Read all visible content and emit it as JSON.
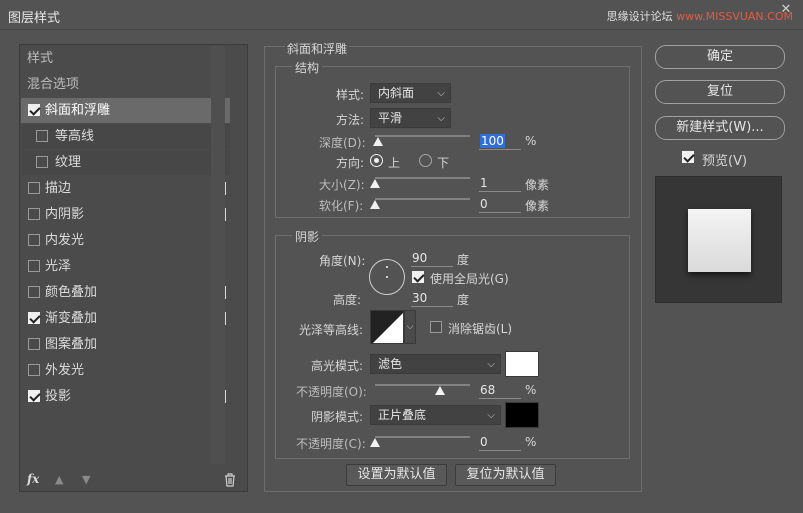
{
  "window": {
    "title": "图层样式",
    "close_label": "✕",
    "watermark": {
      "prefix": "思缘设计论坛 ",
      "highlight": "www.MISSVUAN.COM"
    }
  },
  "left_panel": {
    "items": [
      {
        "label": "样式",
        "checkbox": false,
        "checked": false,
        "plus": false,
        "selected": false
      },
      {
        "label": "混合选项",
        "checkbox": false,
        "checked": false,
        "plus": false,
        "selected": false
      },
      {
        "label": "斜面和浮雕",
        "checkbox": true,
        "checked": true,
        "plus": false,
        "selected": true
      },
      {
        "label": "等高线",
        "checkbox": true,
        "checked": false,
        "plus": false,
        "selected": false,
        "sub": true
      },
      {
        "label": "纹理",
        "checkbox": true,
        "checked": false,
        "plus": false,
        "selected": false,
        "sub": true
      },
      {
        "label": "描边",
        "checkbox": true,
        "checked": false,
        "plus": true,
        "selected": false
      },
      {
        "label": "内阴影",
        "checkbox": true,
        "checked": false,
        "plus": true,
        "selected": false
      },
      {
        "label": "内发光",
        "checkbox": true,
        "checked": false,
        "plus": false,
        "selected": false
      },
      {
        "label": "光泽",
        "checkbox": true,
        "checked": false,
        "plus": false,
        "selected": false
      },
      {
        "label": "颜色叠加",
        "checkbox": true,
        "checked": false,
        "plus": true,
        "selected": false
      },
      {
        "label": "渐变叠加",
        "checkbox": true,
        "checked": true,
        "plus": true,
        "selected": false
      },
      {
        "label": "图案叠加",
        "checkbox": true,
        "checked": false,
        "plus": false,
        "selected": false
      },
      {
        "label": "外发光",
        "checkbox": true,
        "checked": false,
        "plus": false,
        "selected": false
      },
      {
        "label": "投影",
        "checkbox": true,
        "checked": true,
        "plus": true,
        "selected": false
      }
    ],
    "footer": {
      "fx_label": "fx",
      "up_icon": "arrow-up-icon",
      "down_icon": "arrow-down-icon",
      "trash_icon": "trash-icon"
    }
  },
  "bevel": {
    "section_title": "斜面和浮雕",
    "structure_title": "结构",
    "style_label": "样式:",
    "style_value": "内斜面",
    "technique_label": "方法:",
    "technique_value": "平滑",
    "depth_label": "深度(D):",
    "depth_value": "100",
    "depth_unit": "%",
    "depth_level": 0.03,
    "direction_label": "方向:",
    "direction_up": "上",
    "direction_down": "下",
    "size_label": "大小(Z):",
    "size_value": "1",
    "size_unit": "像素",
    "size_level": 0.0,
    "soften_label": "软化(F):",
    "soften_value": "0",
    "soften_unit": "像素",
    "soften_level": 0.0
  },
  "shading": {
    "title": "阴影",
    "angle_label": "角度(N):",
    "angle_value": "90",
    "angle_unit": "度",
    "global_light_label": "使用全局光(G)",
    "altitude_label": "高度:",
    "altitude_value": "30",
    "altitude_unit": "度",
    "gloss_contour_label": "光泽等高线:",
    "anti_alias_label": "消除锯齿(L)",
    "highlight_mode_label": "高光模式:",
    "highlight_mode_value": "滤色",
    "highlight_color": "#ffffff",
    "highlight_opacity_label": "不透明度(O):",
    "highlight_opacity_value": "68",
    "highlight_opacity_unit": "%",
    "highlight_opacity_level": 0.68,
    "shadow_mode_label": "阴影模式:",
    "shadow_mode_value": "正片叠底",
    "shadow_color": "#000000",
    "shadow_opacity_label": "不透明度(C):",
    "shadow_opacity_value": "0",
    "shadow_opacity_unit": "%",
    "shadow_opacity_level": 0.0
  },
  "bottom_buttons": {
    "make_default": "设置为默认值",
    "reset_default": "复位为默认值"
  },
  "right_buttons": {
    "ok": "确定",
    "reset": "复位",
    "new_style": "新建样式(W)...",
    "preview_label": "预览(V)"
  }
}
